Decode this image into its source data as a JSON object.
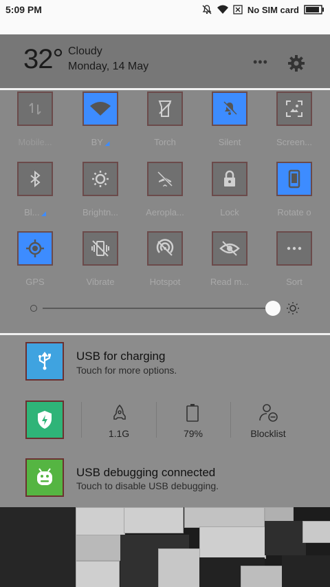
{
  "status_bar": {
    "time": "5:09 PM",
    "carrier": "No SIM card"
  },
  "weather": {
    "temperature": "32°",
    "condition": "Cloudy",
    "date": "Monday, 14 May"
  },
  "quick_settings": {
    "tiles": [
      {
        "label": "Mobile...",
        "icon": "mobile-data-icon",
        "on": false
      },
      {
        "label": "BY",
        "icon": "wifi-icon",
        "on": true
      },
      {
        "label": "Torch",
        "icon": "torch-icon",
        "on": false
      },
      {
        "label": "Silent",
        "icon": "silent-bell-icon",
        "on": true
      },
      {
        "label": "Screen...",
        "icon": "screenshot-icon",
        "on": false
      },
      {
        "label": "Bl...",
        "icon": "bluetooth-icon",
        "on": false
      },
      {
        "label": "Brightn...",
        "icon": "brightness-icon",
        "on": false
      },
      {
        "label": "Aeropla...",
        "icon": "airplane-icon",
        "on": false
      },
      {
        "label": "Lock",
        "icon": "lock-icon",
        "on": false
      },
      {
        "label": "Rotate o",
        "icon": "rotate-icon",
        "on": true
      },
      {
        "label": "GPS",
        "icon": "gps-icon",
        "on": true
      },
      {
        "label": "Vibrate",
        "icon": "vibrate-icon",
        "on": false
      },
      {
        "label": "Hotspot",
        "icon": "hotspot-icon",
        "on": false
      },
      {
        "label": "Read m...",
        "icon": "reading-mode-icon",
        "on": false
      },
      {
        "label": "Sort",
        "icon": "more-icon",
        "on": false
      }
    ],
    "brightness_level": 0.99
  },
  "notifications": {
    "usb": {
      "title": "USB for charging",
      "subtitle": "Touch for more options."
    },
    "security": {
      "stats": [
        {
          "value": "1.1G",
          "icon": "rocket-icon"
        },
        {
          "value": "79%",
          "icon": "battery-icon"
        },
        {
          "value": "Blocklist",
          "icon": "person-block-icon"
        }
      ]
    },
    "debug": {
      "title": "USB debugging connected",
      "subtitle": "Touch to disable USB debugging."
    }
  },
  "colors": {
    "accent": "#3d8cff",
    "usb_icon": "#3fa3e0",
    "security_icon": "#2fb478",
    "android_icon": "#55b542"
  }
}
